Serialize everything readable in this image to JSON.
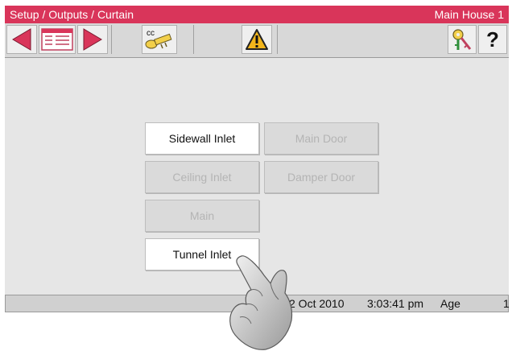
{
  "titlebar": {
    "breadcrumb": "Setup / Outputs / Curtain",
    "location": "Main House 1"
  },
  "toolbar": {
    "icons": [
      "back-arrow-icon",
      "list-icon",
      "forward-arrow-icon",
      "cc-key-icon",
      "warning-icon",
      "keys-icon",
      "help-icon"
    ],
    "help_label": "?",
    "cc_label": "cc"
  },
  "menu": {
    "sidewall_inlet": "Sidewall Inlet",
    "main_door": "Main Door",
    "ceiling_inlet": "Ceiling Inlet",
    "damper_door": "Damper Door",
    "main": "Main",
    "tunnel_inlet": "Tunnel Inlet"
  },
  "status": {
    "date": "2 Oct 2010",
    "time": "3:03:41 pm",
    "age_label": "Age",
    "age_value": "1"
  },
  "colors": {
    "titlebar": "#d9355a",
    "arrow": "#d9355a",
    "warning": "#f2b51b"
  }
}
